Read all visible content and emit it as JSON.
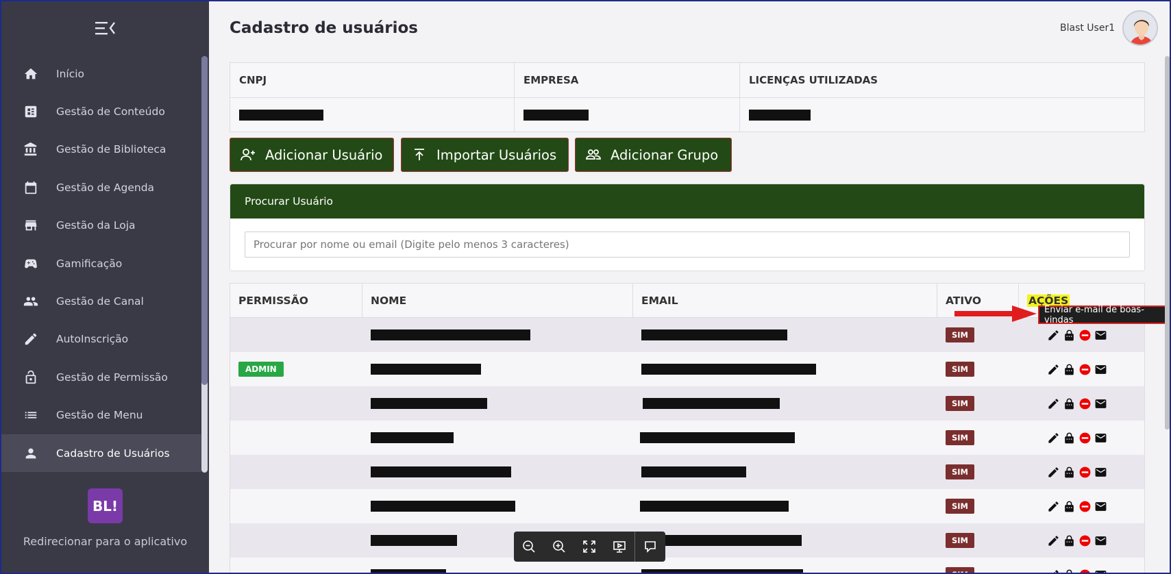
{
  "sidebar": {
    "items": [
      {
        "label": "Início",
        "icon": "home-icon"
      },
      {
        "label": "Gestão de Conteúdo",
        "icon": "content-icon"
      },
      {
        "label": "Gestão de Biblioteca",
        "icon": "library-icon"
      },
      {
        "label": "Gestão de Agenda",
        "icon": "calendar-icon"
      },
      {
        "label": "Gestão da Loja",
        "icon": "store-icon"
      },
      {
        "label": "Gamificação",
        "icon": "gamepad-icon"
      },
      {
        "label": "Gestão de Canal",
        "icon": "group-icon"
      },
      {
        "label": "AutoInscrição",
        "icon": "pencil-icon"
      },
      {
        "label": "Gestão de Permissão",
        "icon": "lock-icon"
      },
      {
        "label": "Gestão de Menu",
        "icon": "list-icon"
      },
      {
        "label": "Cadastro de Usuários",
        "icon": "person-icon"
      }
    ],
    "logo_text": "BL!",
    "redirect_label": "Redirecionar para o aplicativo"
  },
  "header": {
    "title": "Cadastro de usuários",
    "user_name": "Blast User1"
  },
  "company": {
    "headers": [
      "CNPJ",
      "EMPRESA",
      "LICENÇAS UTILIZADAS"
    ]
  },
  "buttons": {
    "add_user": "Adicionar Usuário",
    "import_users": "Importar Usuários",
    "add_group": "Adicionar Grupo"
  },
  "search": {
    "title": "Procurar Usuário",
    "placeholder": "Procurar por nome ou email (Digite pelo menos 3 caracteres)"
  },
  "users_table": {
    "headers": [
      "PERMISSÃO",
      "NOME",
      "EMAIL",
      "ATIVO",
      "AÇÕES"
    ],
    "rows": [
      {
        "permission": "",
        "active": "SIM"
      },
      {
        "permission": "ADMIN",
        "active": "SIM"
      },
      {
        "permission": "",
        "active": "SIM"
      },
      {
        "permission": "",
        "active": "SIM"
      },
      {
        "permission": "",
        "active": "SIM"
      },
      {
        "permission": "",
        "active": "SIM"
      },
      {
        "permission": "",
        "active": "SIM"
      },
      {
        "permission": "",
        "active": "SIM"
      }
    ]
  },
  "tooltip": "Enviar e-mail de boas-vindas",
  "colors": {
    "sidebar_bg": "#3a3a47",
    "brand_green": "#234a16",
    "admin_badge": "#28a745",
    "active_badge": "#7b2e2e",
    "highlight": "#f3f31a",
    "annotation_red": "#e01d1d"
  }
}
